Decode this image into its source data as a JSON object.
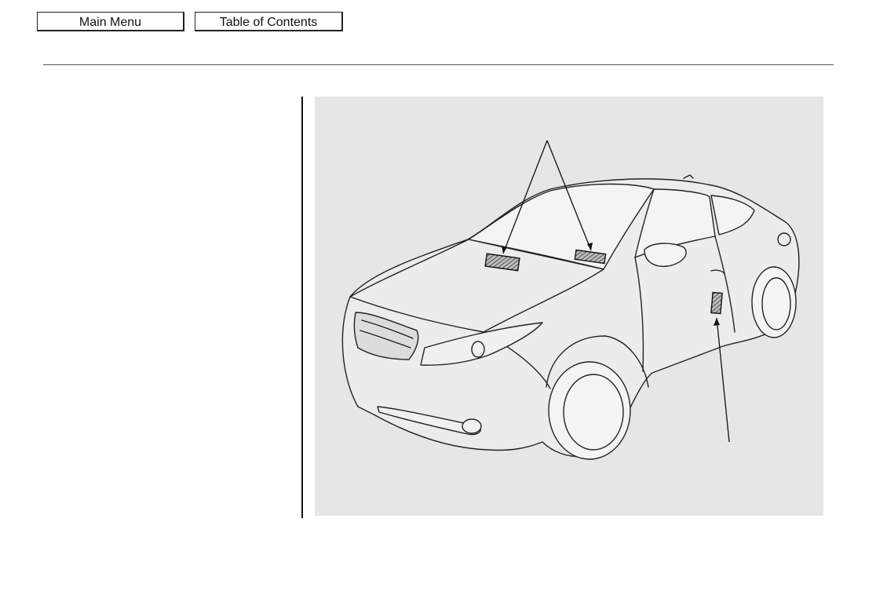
{
  "nav": {
    "main_menu_label": "Main Menu",
    "toc_label": "Table of Contents"
  },
  "figure": {
    "subject": "car-label-locations-illustration"
  }
}
